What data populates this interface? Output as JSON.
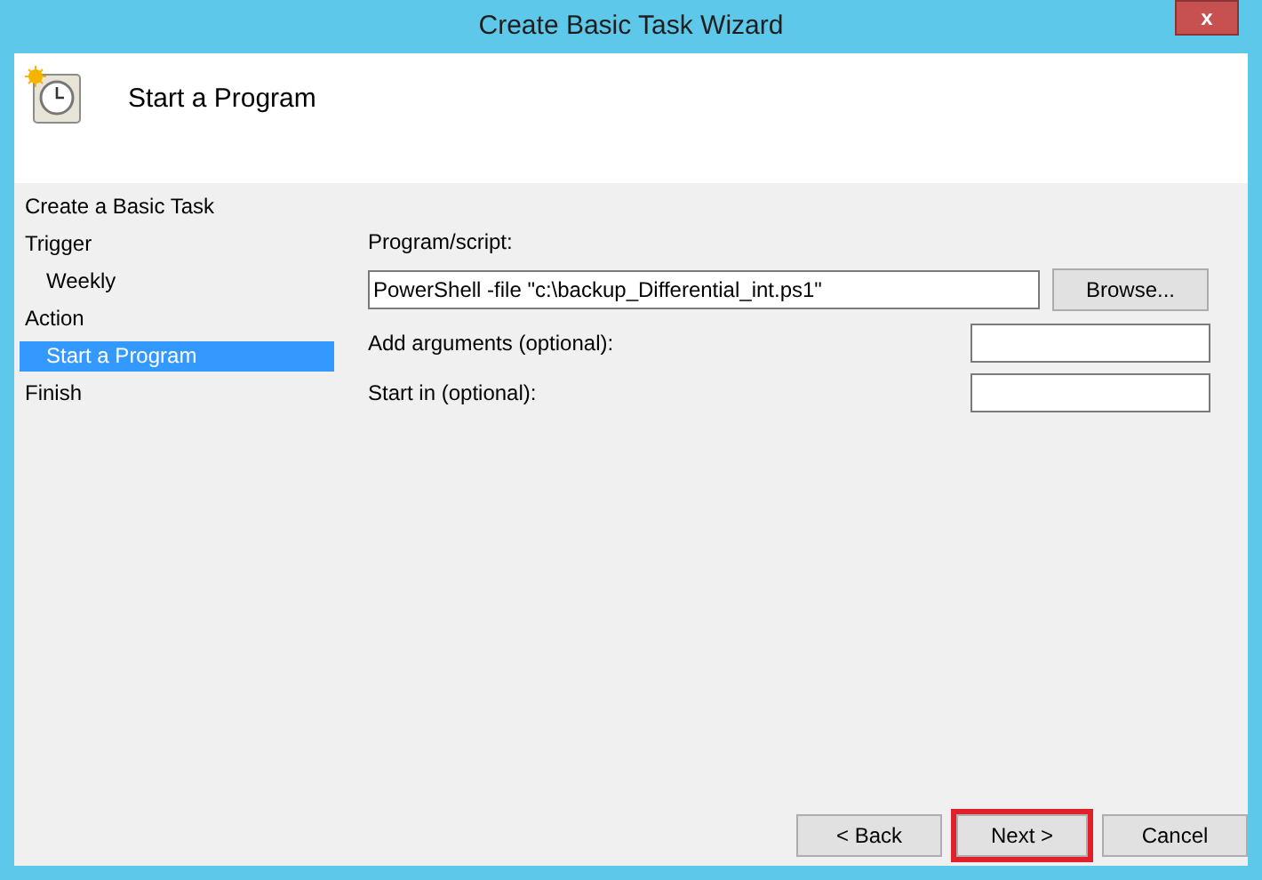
{
  "window": {
    "title": "Create Basic Task Wizard",
    "close": "x"
  },
  "header": {
    "title": "Start a Program"
  },
  "steps": [
    {
      "label": "Create a Basic Task",
      "selected": false
    },
    {
      "label": "Trigger",
      "selected": false,
      "children": [
        {
          "label": "Weekly",
          "selected": false
        }
      ]
    },
    {
      "label": "Action",
      "selected": false,
      "children": [
        {
          "label": "Start a Program",
          "selected": true
        }
      ]
    },
    {
      "label": "Finish",
      "selected": false
    }
  ],
  "program": {
    "label": "Program/script:",
    "value": "PowerShell -file \"c:\\backup_Differential_int.ps1\"",
    "browse": "Browse..."
  },
  "fields": [
    {
      "label": "Add arguments (optional):"
    },
    {
      "label": "Start in (optional):"
    }
  ],
  "buttons": [
    {
      "label": "< Back",
      "highlighted": false
    },
    {
      "label": "Next >",
      "highlighted": true
    },
    {
      "label": "Cancel",
      "highlighted": false
    }
  ]
}
